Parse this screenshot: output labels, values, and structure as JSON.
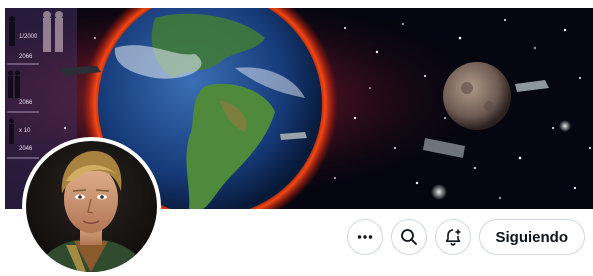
{
  "banner": {
    "overlay_labels": [
      "1/2000",
      "2066",
      "2066",
      "x 10",
      "2046"
    ]
  },
  "profile": {
    "avatar_alt": "avatar"
  },
  "actions": {
    "more_icon": "more-horizontal-icon",
    "search_icon": "search-icon",
    "notify_icon": "bell-plus-icon",
    "follow_label": "Siguiendo"
  },
  "colors": {
    "border": "#cfd9de",
    "text": "#0f1419"
  }
}
